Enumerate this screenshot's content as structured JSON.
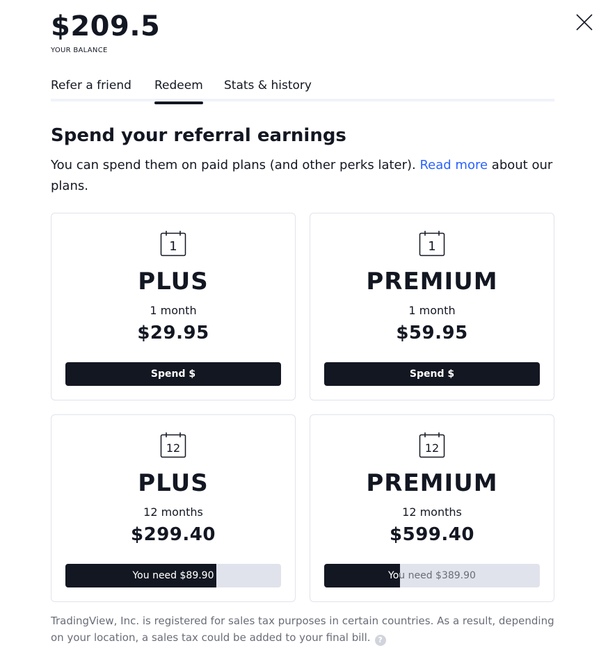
{
  "balance": {
    "amount": "$209.5",
    "label": "YOUR BALANCE"
  },
  "tabs": [
    {
      "label": "Refer a friend",
      "active": false
    },
    {
      "label": "Redeem",
      "active": true
    },
    {
      "label": "Stats & history",
      "active": false
    }
  ],
  "section": {
    "heading": "Spend your referral earnings",
    "desc_before": "You can spend them on paid plans (and other perks later). ",
    "link_text": "Read more",
    "desc_after": " about our plans."
  },
  "plans": [
    {
      "calendar": "1",
      "name": "PLUS",
      "duration": "1 month",
      "price": "$29.95",
      "button": "Spend $"
    },
    {
      "calendar": "1",
      "name": "PREMIUM",
      "duration": "1 month",
      "price": "$59.95",
      "button": "Spend $"
    },
    {
      "calendar": "12",
      "name": "PLUS",
      "duration": "12 months",
      "price": "$299.40",
      "need_text": "You need $89.90",
      "progress_pct": 70
    },
    {
      "calendar": "12",
      "name": "PREMIUM",
      "duration": "12 months",
      "price": "$599.40",
      "need_text": "You need $389.90",
      "progress_pct": 35
    }
  ],
  "footer": {
    "text": "TradingView, Inc. is registered for sales tax purposes in certain countries. As a result, depending on your location, a sales tax could be added to your final bill.",
    "help_icon": "?"
  },
  "colors": {
    "text": "#131722",
    "link": "#2962ff",
    "button": "#131722",
    "muted": "#6a6d78",
    "border": "#e0e3eb"
  },
  "icons": {
    "close": "close-icon",
    "calendar": "calendar-icon",
    "help": "help-icon"
  }
}
